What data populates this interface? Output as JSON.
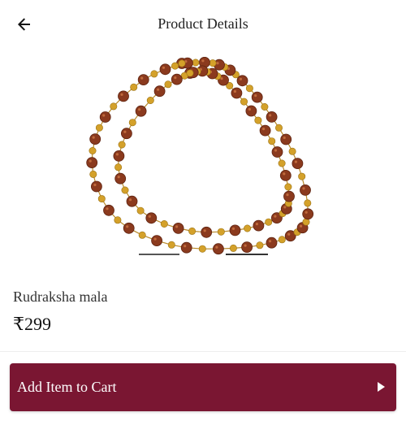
{
  "header": {
    "title": "Product Details",
    "back_icon": "arrow-left-icon"
  },
  "carousel": {
    "image": "rudraksha-mala-photo",
    "slide_count": 2,
    "active_index": 1
  },
  "product": {
    "name": "Rudraksha mala",
    "price": "₹299"
  },
  "cart": {
    "label": "Add Item to Cart",
    "arrow_icon": "play-right-icon"
  },
  "colors": {
    "accent": "#7a1632",
    "bead": "#8b3a1e",
    "gold": "#d4a12a"
  }
}
